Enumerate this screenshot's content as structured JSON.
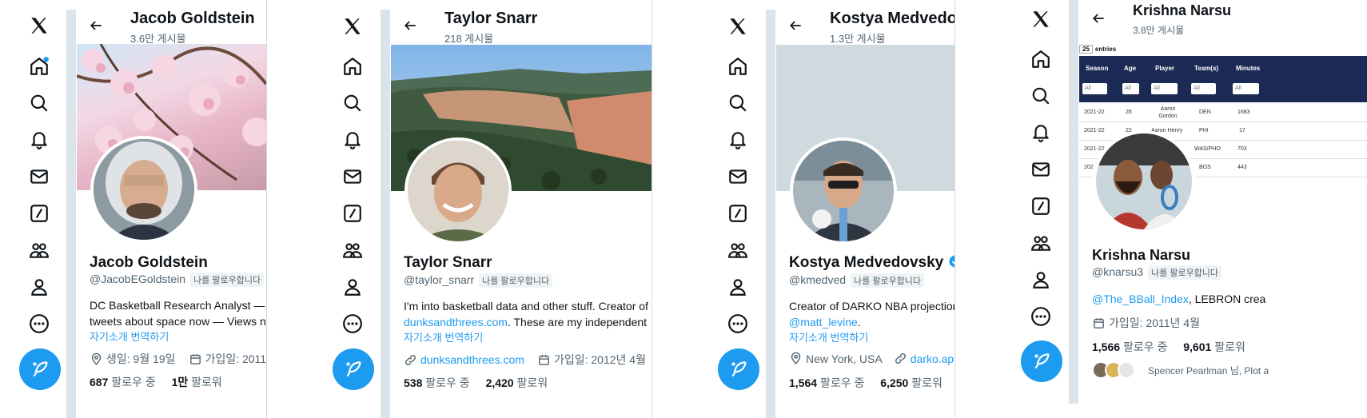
{
  "panels": [
    {
      "name": "Jacob Goldstein",
      "posts": "3.6만 게시물",
      "display_name": "Jacob Goldstein",
      "handle": "@JacobEGoldstein",
      "follows_you": "나를 팔로우합니다",
      "bio_line1": "DC Basketball Research Analyst —",
      "bio_line2": "tweets about space now — Views n",
      "translate": "자기소개 번역하기",
      "birthday": "생일: 9월 19일",
      "joined": "가입일: 2011",
      "following_count": "687",
      "following_label": "팔로우 중",
      "followers_count": "1만",
      "followers_label": "팔로워"
    },
    {
      "name": "Taylor Snarr",
      "posts": "218 게시물",
      "display_name": "Taylor Snarr",
      "handle": "@taylor_snarr",
      "follows_you": "나를 팔로우합니다",
      "bio_line1": "I'm into basketball data and other stuff. Creator of",
      "bio_line2_link": "dunksandthrees.com",
      "bio_line2_rest": ". These are my independent",
      "translate": "자기소개 번역하기",
      "website": "dunksandthrees.com",
      "joined": "가입일: 2012년 4월",
      "following_count": "538",
      "following_label": "팔로우 중",
      "followers_count": "2,420",
      "followers_label": "팔로워"
    },
    {
      "name": "Kostya Medvedovs",
      "posts": "1.3만 게시물",
      "display_name": "Kostya Medvedovsky",
      "handle": "@kmedved",
      "follows_you": "나를 팔로우합니다",
      "bio_line1": "Creator of DARKO NBA projection",
      "bio_line2_link": "@matt_levine",
      "bio_line2_rest": ".",
      "translate": "자기소개 번역하기",
      "location": "New York, USA",
      "website": "darko.app",
      "following_count": "1,564",
      "following_label": "팔로우 중",
      "followers_count": "6,250",
      "followers_label": "팔로워"
    },
    {
      "name": "Krishna Narsu",
      "posts": "3.8만 게시물",
      "display_name": "Krishna Narsu",
      "handle": "@knarsu3",
      "follows_you": "나를 팔로우합니다",
      "bio_line1_link": "@The_BBall_Index",
      "bio_line1_rest": ", LEBRON crea",
      "joined": "가입일: 2011년 4월",
      "following_count": "1,566",
      "following_label": "팔로우 중",
      "followers_count": "9,601",
      "followers_label": "팔로워",
      "followed_by": "Spencer Pearlman 님, Plot a",
      "banner_table": {
        "entries_select": "25",
        "entries_label": "entries",
        "headers": [
          "Season",
          "Age",
          "Player",
          "Team(s)",
          "Minutes"
        ],
        "filter": "All",
        "rows": [
          [
            "2021-22",
            "26",
            "Aaron Gordon",
            "DEN",
            "1683"
          ],
          [
            "2021-22",
            "22",
            "Aaron Henry",
            "PHI",
            "17"
          ],
          [
            "2021-22",
            "",
            "",
            "WAS/PHO",
            "703"
          ],
          [
            "202",
            "",
            "",
            "BOS",
            "443"
          ]
        ]
      }
    }
  ],
  "colors": {
    "accent": "#1d9bf0",
    "text": "#0f1419",
    "muted": "#536471"
  }
}
